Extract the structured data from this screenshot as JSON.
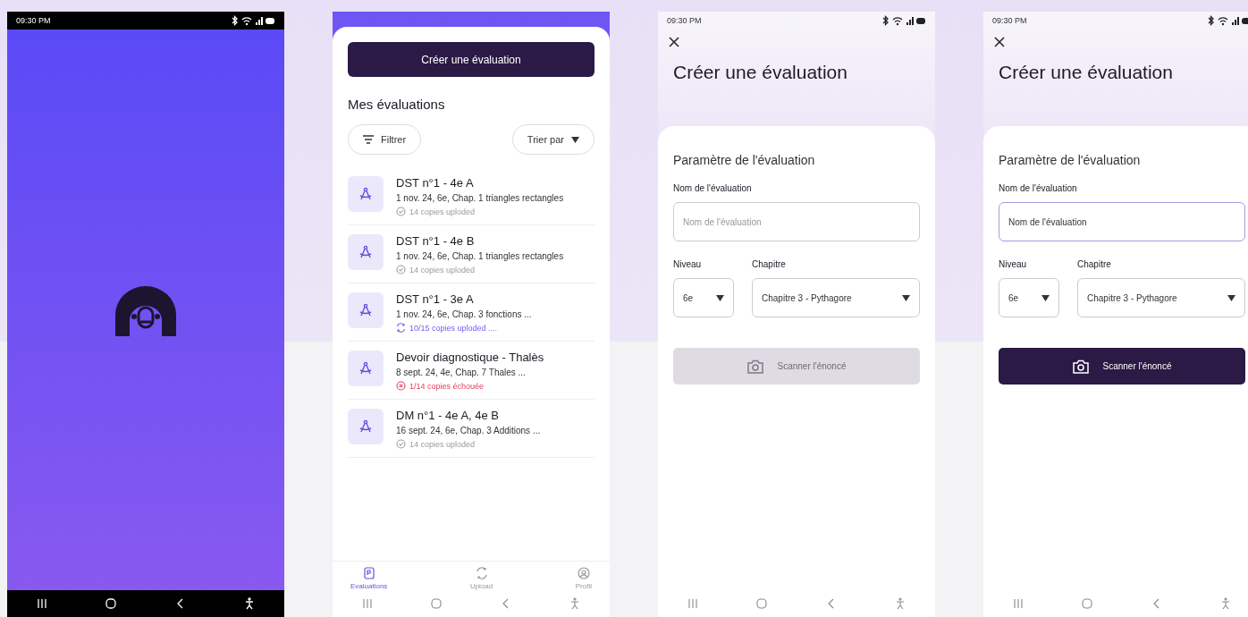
{
  "screens": [
    {
      "kind": "splash",
      "status_bar": {
        "time": "09:30 PM"
      }
    },
    {
      "kind": "list",
      "create_button": "Créer une évaluation",
      "section_title": "Mes évaluations",
      "filter_button": "Filtrer",
      "sort_button": "Trier par",
      "evaluations": [
        {
          "title": "DST n°1 - 4e A",
          "details": "1 nov. 24, 6e, Chap. 1 triangles rectangles",
          "status": {
            "kind": "done",
            "text": "14 copies uploded"
          }
        },
        {
          "title": "DST n°1 - 4e B",
          "details": "1 nov. 24, 6e, Chap. 1 triangles rectangles",
          "status": {
            "kind": "done",
            "text": "14 copies uploded"
          }
        },
        {
          "title": "DST n°1 - 3e A",
          "details": "1 nov. 24, 6e, Chap. 3 fonctions ...",
          "status": {
            "kind": "syncing",
            "text": "10/15 copies uploded ...."
          }
        },
        {
          "title": "Devoir diagnostique - Thalès",
          "details": "8 sept. 24, 4e, Chap. 7 Thales ...",
          "status": {
            "kind": "failed",
            "text": "1/14 copies échouée"
          }
        },
        {
          "title": "DM n°1 - 4e A, 4e B",
          "details": "16 sept. 24, 6e, Chap. 3 Additions ...",
          "status": {
            "kind": "done",
            "text": "14 copies uploded"
          }
        }
      ],
      "tabs": [
        {
          "label": "Evaluations",
          "selected": true
        },
        {
          "label": "Upload",
          "selected": false
        },
        {
          "label": "Profil",
          "selected": false
        }
      ]
    },
    {
      "kind": "form",
      "status_bar": {
        "time": "09:30 PM"
      },
      "title": "Créer une évaluation",
      "section_title": "Paramètre de l'évaluation",
      "name_label": "Nom de l'évaluation",
      "name_field": {
        "placeholder": "Nom de l'évaluation",
        "focused": false
      },
      "level_label": "Niveau",
      "level_value": "6e",
      "chapter_label": "Chapitre",
      "chapter_value": "Chapitre 3 - Pythagore",
      "scan_button": {
        "label": "Scanner l'énoncé",
        "disabled": true
      }
    },
    {
      "kind": "form",
      "status_bar": {
        "time": "09:30 PM"
      },
      "title": "Créer une évaluation",
      "section_title": "Paramètre de l'évaluation",
      "name_label": "Nom de l'évaluation",
      "name_field": {
        "value": "Nom de l'évaluation",
        "focused": true
      },
      "level_label": "Niveau",
      "level_value": "6e",
      "chapter_label": "Chapitre",
      "chapter_value": "Chapitre 3 - Pythagore",
      "scan_button": {
        "label": "Scanner l'énoncé",
        "disabled": false
      }
    }
  ]
}
